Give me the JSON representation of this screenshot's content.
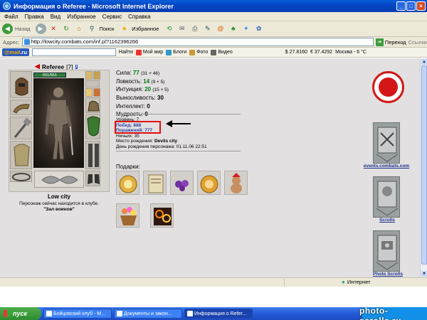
{
  "window": {
    "title": "Информация о Referee - Microsoft Internet Explorer"
  },
  "menu": [
    "Файл",
    "Правка",
    "Вид",
    "Избранное",
    "Сервис",
    "Справка"
  ],
  "toolbar": {
    "back_label": "Назад",
    "search_label": "Поиск",
    "favorites_label": "Избранное"
  },
  "address": {
    "label": "Адрес:",
    "url": "http://lowcity.combats.com/inf.pl?1162396266",
    "go_label": "Переход",
    "links_label": "Ссылки"
  },
  "mailbar": {
    "logo_mail": "@mail",
    "logo_ru": ".ru",
    "find_label": "Найти",
    "mir": "Мой мир",
    "blogs": "Блоги",
    "photo": "Фото",
    "video": "Видео",
    "usd": "$ 27.8160",
    "eur": "€ 37.4292",
    "weather": "Москва - 6 °C"
  },
  "character": {
    "name": "Referee",
    "level": "[7]",
    "info_badge": "i",
    "hp": "551/551",
    "city": "Low city",
    "club_text": "Персонаж сейчас находится в клубе.",
    "hall": "\"Зал воинов\""
  },
  "stats": [
    {
      "label": "Сила:",
      "value": "77",
      "extra": "(31 + 46)"
    },
    {
      "label": "Ловкость:",
      "value": "14",
      "extra": "(9 + 5)"
    },
    {
      "label": "Интуиция:",
      "value": "20",
      "extra": "(15 + 5)"
    },
    {
      "label": "Выносливость:",
      "value": "30",
      "extra": ""
    },
    {
      "label": "Интеллект:",
      "value": "0",
      "extra": ""
    },
    {
      "label": "Мудрость:",
      "value": "0",
      "extra": ""
    }
  ],
  "info": {
    "level": "Уровень: 7",
    "wins": "Побед: 888",
    "losses": "Поражений: 777",
    "draws": "Ничьих: 35",
    "birthplace_label": "Место рождения:",
    "birthplace": "Devils city",
    "birthday": "День рождения персонажа: 01.11.06 22:51"
  },
  "gifts": {
    "label": "Подарки:"
  },
  "sidebar": {
    "events_link": "events.combats.com",
    "scrolls_link": "Scrolls",
    "photo_link": "Photo Scrolls"
  },
  "status": {
    "zone": "Интернет"
  },
  "taskbar": {
    "start": "пуск",
    "tasks": [
      "Бойцовский клуб - M...",
      "Документы и закон...",
      "Информация о Refer..."
    ],
    "watermark": "photo-scrolls.ru"
  }
}
